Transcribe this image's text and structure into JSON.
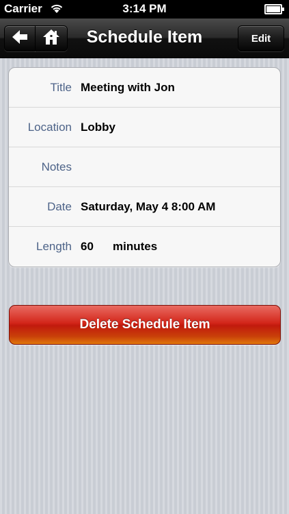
{
  "status_bar": {
    "carrier": "Carrier",
    "time": "3:14 PM"
  },
  "nav": {
    "title": "Schedule Item",
    "edit_label": "Edit",
    "back_icon": "back-arrow-icon",
    "home_icon": "home-icon"
  },
  "details": {
    "rows": [
      {
        "label": "Title",
        "value": "Meeting with Jon"
      },
      {
        "label": "Location",
        "value": "Lobby"
      },
      {
        "label": "Notes",
        "value": ""
      },
      {
        "label": "Date",
        "value": "Saturday, May 4 8:00 AM"
      },
      {
        "label": "Length",
        "value": "60",
        "unit": "minutes"
      }
    ]
  },
  "actions": {
    "delete_label": "Delete Schedule Item"
  },
  "colors": {
    "label": "#4d6388",
    "delete": "#c11a0d",
    "nav": "#1a1a1a"
  }
}
